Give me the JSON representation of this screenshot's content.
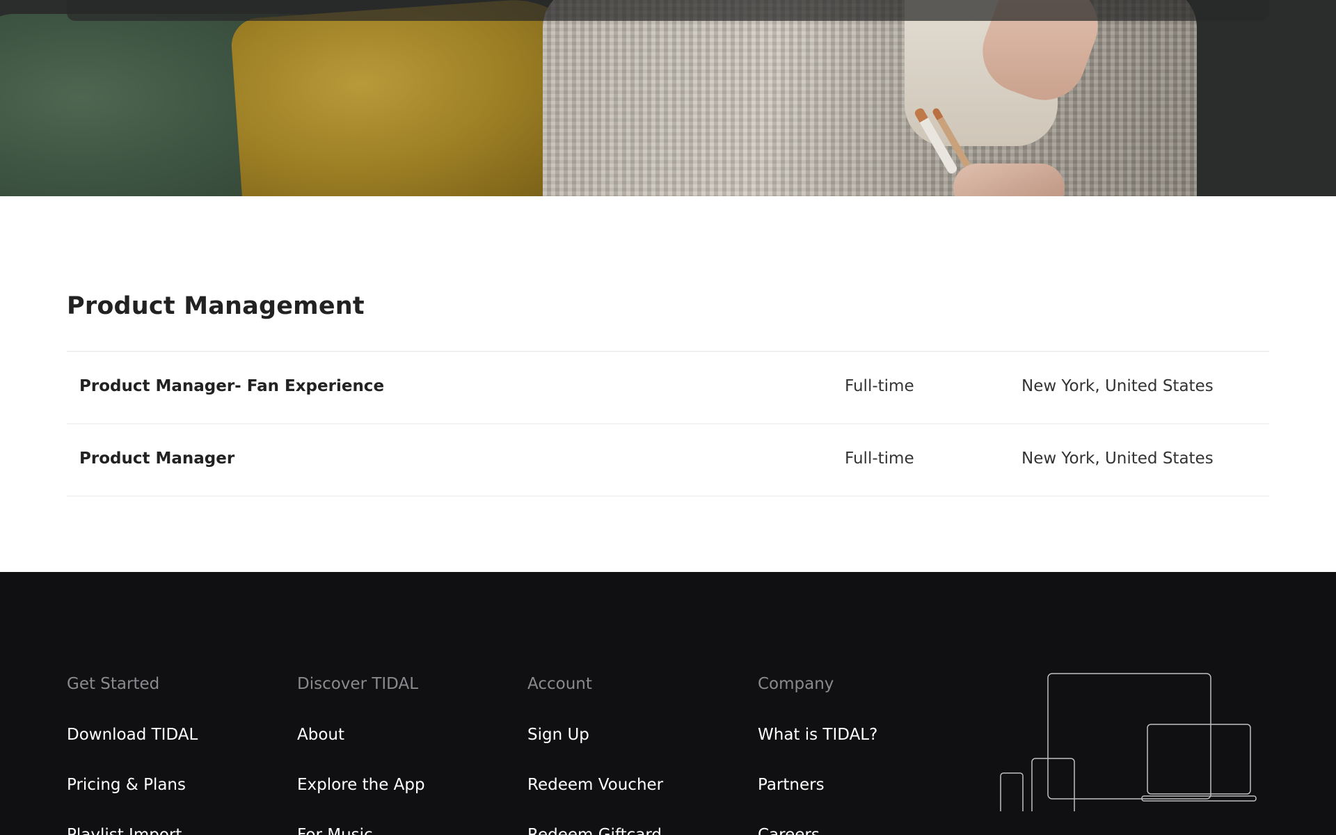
{
  "section": {
    "title": "Product Management",
    "jobs": [
      {
        "title": "Product Manager- Fan Experience",
        "type": "Full-time",
        "location": "New York, United States"
      },
      {
        "title": "Product Manager",
        "type": "Full-time",
        "location": "New York, United States"
      }
    ]
  },
  "footer": {
    "columns": [
      {
        "heading": "Get Started",
        "links": [
          "Download TIDAL",
          "Pricing & Plans",
          "Playlist Import"
        ]
      },
      {
        "heading": "Discover TIDAL",
        "links": [
          "About",
          "Explore the App",
          "For Music"
        ]
      },
      {
        "heading": "Account",
        "links": [
          "Sign Up",
          "Redeem Voucher",
          "Redeem Giftcard"
        ]
      },
      {
        "heading": "Company",
        "links": [
          "What is TIDAL?",
          "Partners",
          "Careers"
        ]
      }
    ],
    "illustration": "devices-icon"
  },
  "colors": {
    "footer_bg": "#101012",
    "footer_heading": "#8a8a8e",
    "footer_link": "#ffffff",
    "text": "#222222"
  }
}
